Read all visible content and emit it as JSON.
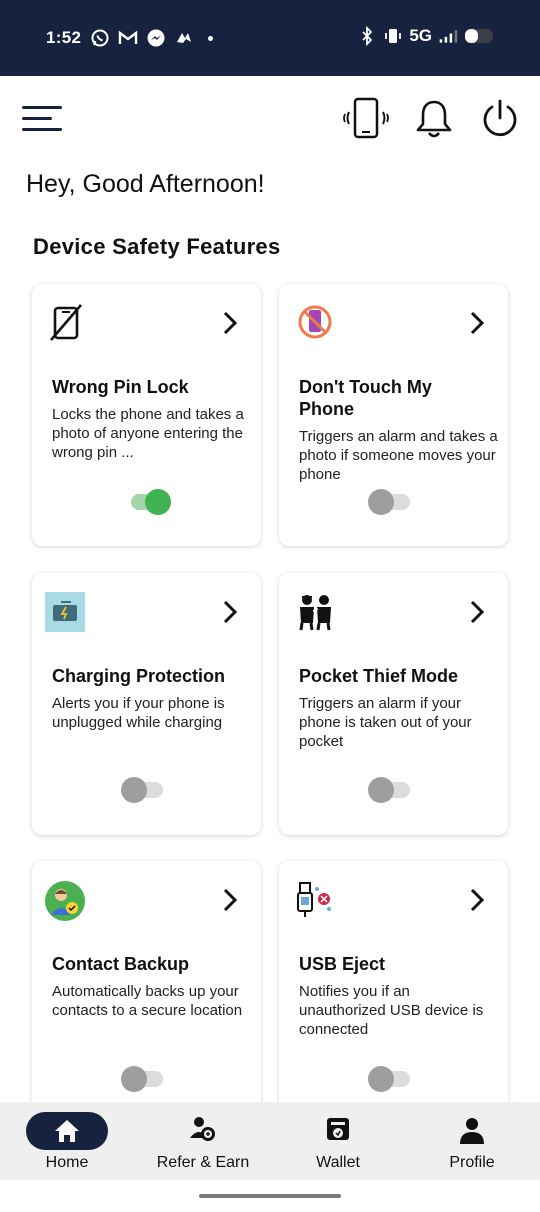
{
  "status_bar": {
    "time": "1:52",
    "network": "5G",
    "left_icons": [
      "whatsapp-icon",
      "gmail-icon",
      "messenger-icon",
      "app-icon",
      "dot-icon"
    ],
    "right_icons": [
      "bluetooth-icon",
      "vibrate-icon",
      "signal-icon",
      "battery-icon"
    ]
  },
  "app_bar": {
    "icons": [
      "menu-icon",
      "vibrate-phone-icon",
      "bell-icon",
      "power-icon"
    ]
  },
  "greeting": "Hey, Good Afternoon!",
  "section_title": "Device Safety Features",
  "features": [
    {
      "title": "Wrong Pin Lock",
      "description": "Locks the phone and takes a photo of anyone entering the wrong pin ...",
      "icon": "phone-lock-icon",
      "enabled": true
    },
    {
      "title": "Don't Touch My Phone",
      "description": "Triggers an alarm and takes a photo if someone moves your phone",
      "icon": "no-touch-phone-icon",
      "enabled": false
    },
    {
      "title": "Charging Protection",
      "description": "Alerts you if your phone is unplugged while charging",
      "icon": "charging-icon",
      "enabled": false
    },
    {
      "title": "Pocket Thief Mode",
      "description": "Triggers an alarm if your phone is taken out of your pocket",
      "icon": "thief-icon",
      "enabled": false
    },
    {
      "title": "Contact Backup",
      "description": "Automatically backs up your contacts to a secure location",
      "icon": "contact-backup-icon",
      "enabled": false
    },
    {
      "title": "USB Eject",
      "description": "Notifies you if an unauthorized USB device is connected",
      "icon": "usb-icon",
      "enabled": false
    }
  ],
  "bottom_nav": {
    "items": [
      {
        "label": "Home",
        "icon": "home-icon",
        "active": true
      },
      {
        "label": "Refer & Earn",
        "icon": "refer-icon",
        "active": false
      },
      {
        "label": "Wallet",
        "icon": "wallet-icon",
        "active": false
      },
      {
        "label": "Profile",
        "icon": "profile-icon",
        "active": false
      }
    ]
  },
  "colors": {
    "primary": "#17233e",
    "toggle_on": "#3fb34f",
    "toggle_off": "#9e9e9e",
    "nav_background": "#efefef"
  }
}
